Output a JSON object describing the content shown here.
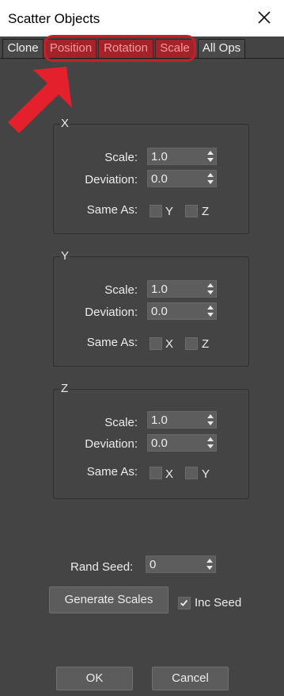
{
  "window": {
    "title": "Scatter Objects",
    "close_icon": "close-icon"
  },
  "tabs": [
    {
      "label": "Clone",
      "highlighted": false
    },
    {
      "label": "Position",
      "highlighted": true
    },
    {
      "label": "Rotation",
      "highlighted": true
    },
    {
      "label": "Scale",
      "highlighted": true
    },
    {
      "label": "All Ops",
      "highlighted": false
    }
  ],
  "annotation": {
    "arrow_icon": "red-arrow-icon",
    "color": "#e3202c"
  },
  "groups": {
    "x": {
      "title": "X",
      "scale_label": "Scale:",
      "scale_value": "1.0",
      "deviation_label": "Deviation:",
      "deviation_value": "0.0",
      "same_as_label": "Same As:",
      "opt1": "Y",
      "opt2": "Z"
    },
    "y": {
      "title": "Y",
      "scale_label": "Scale:",
      "scale_value": "1.0",
      "deviation_label": "Deviation:",
      "deviation_value": "0.0",
      "same_as_label": "Same As:",
      "opt1": "X",
      "opt2": "Z"
    },
    "z": {
      "title": "Z",
      "scale_label": "Scale:",
      "scale_value": "1.0",
      "deviation_label": "Deviation:",
      "deviation_value": "0.0",
      "same_as_label": "Same As:",
      "opt1": "X",
      "opt2": "Y"
    }
  },
  "seed": {
    "label": "Rand Seed:",
    "value": "0"
  },
  "generate_button": "Generate Scales",
  "inc_seed": {
    "label": "Inc Seed",
    "checked": true
  },
  "footer": {
    "ok": "OK",
    "cancel": "Cancel"
  },
  "colors": {
    "background": "#444444",
    "tab_highlight": "#a4232a",
    "highlight_ring": "#c51f2a"
  }
}
